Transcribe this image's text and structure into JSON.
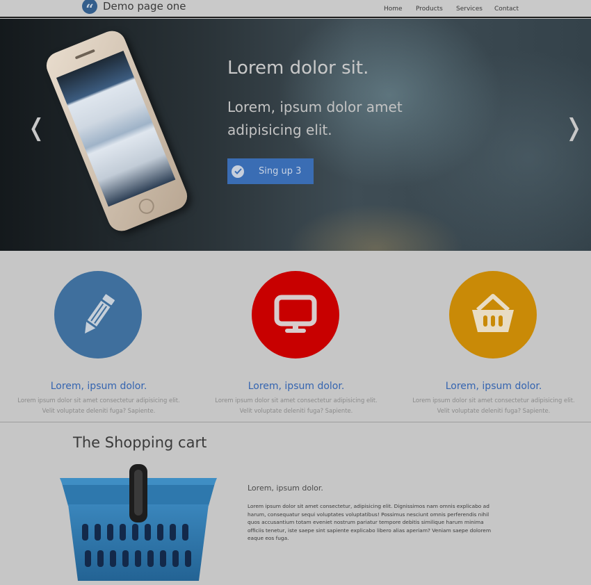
{
  "header": {
    "brand": "Demo page one",
    "nav": [
      "Home",
      "Products",
      "Services",
      "Contact"
    ]
  },
  "hero": {
    "title": "Lorem dolor sit.",
    "subtitle": "Lorem, ipsum dolor amet adipisicing elit.",
    "button_label": "Sing up 3",
    "prev_arrow": "❬",
    "next_arrow": "❭"
  },
  "features": [
    {
      "icon": "pencil-icon",
      "color": "#3f6f9d",
      "title": "Lorem, ipsum dolor.",
      "text": "Lorem ipsum dolor sit amet consectetur adipisicing elit. Velit voluptate deleniti fuga? Sapiente."
    },
    {
      "icon": "monitor-icon",
      "color": "#c80000",
      "title": "Lorem, ipsum dolor.",
      "text": "Lorem ipsum dolor sit amet consectetur adipisicing elit. Velit voluptate deleniti fuga? Sapiente."
    },
    {
      "icon": "basket-icon",
      "color": "#c98a07",
      "title": "Lorem, ipsum dolor.",
      "text": "Lorem ipsum dolor sit amet consectetur adipisicing elit. Velit voluptate deleniti fuga? Sapiente."
    }
  ],
  "cart": {
    "title": "The Shopping cart",
    "heading": "Lorem, ipsum dolor.",
    "body": "Lorem ipsum dolor sit amet consectetur, adipisicing elit. Dignissimos nam omnis explicabo ad harum, consequatur sequi voluptates voluptatibus! Possimus nesciunt omnis perferendis nihil quos accusantium totam eveniet nostrum pariatur tempore debitis similique harum minima officiis tenetur, iste saepe sint sapiente explicabo libero alias aperiam? Veniam saepe dolorem eaque eos fuga."
  },
  "colors": {
    "accent": "#3a6db4",
    "feature_title": "#3464b0"
  }
}
